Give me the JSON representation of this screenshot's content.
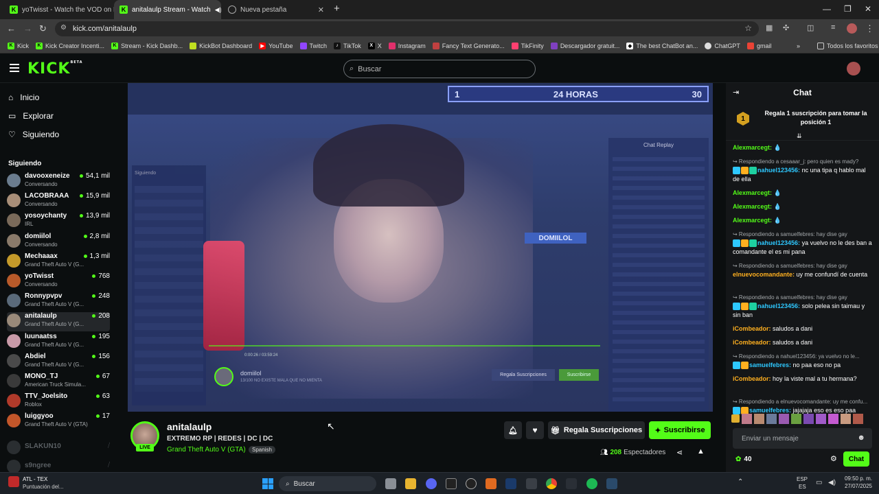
{
  "browser": {
    "tabs": [
      {
        "title": "yoTwisst - Watch the VOD on K"
      },
      {
        "title": "anitalaulp Stream - Watch"
      },
      {
        "title": "Nueva pestaña"
      }
    ],
    "url": "kick.com/anitalaulp",
    "bookmarks": [
      "Kick",
      "Kick Creator Incenti...",
      "Stream - Kick Dashb...",
      "KickBot Dashboard",
      "YouTube",
      "Twitch",
      "TikTok",
      "X",
      "Instagram",
      "Fancy Text Generato...",
      "TikFinity",
      "Descargador gratuit...",
      "The best ChatBot an...",
      "ChatGPT",
      "gmail"
    ],
    "bookmarks_other": "Todos los favoritos"
  },
  "header": {
    "logo": "KICK",
    "beta": "BETA",
    "search_placeholder": "Buscar"
  },
  "sidebar": {
    "nav": [
      {
        "label": "Inicio"
      },
      {
        "label": "Explorar"
      },
      {
        "label": "Siguiendo"
      }
    ],
    "section_title": "Siguiendo",
    "following": [
      {
        "name": "davooxeneize",
        "category": "Conversando",
        "viewers": "54,1 mil",
        "color": "#6b7d8f"
      },
      {
        "name": "LACOBRAAA",
        "category": "Conversando",
        "viewers": "15,9 mil",
        "color": "#a88e78"
      },
      {
        "name": "yosoychanty",
        "category": "IRL",
        "viewers": "13,9 mil",
        "color": "#7a6a5a"
      },
      {
        "name": "domiilol",
        "category": "Conversando",
        "viewers": "2,8 mil",
        "color": "#8a7a6a"
      },
      {
        "name": "Mechaaax",
        "category": "Grand Theft Auto V (G...",
        "viewers": "1,3 mil",
        "color": "#c49a2a"
      },
      {
        "name": "yoTwisst",
        "category": "Conversando",
        "viewers": "768",
        "color": "#b85a2a"
      },
      {
        "name": "Ronnypvpv",
        "category": "Grand Theft Auto V (G...",
        "viewers": "248",
        "color": "#5a6a7a"
      },
      {
        "name": "anitalaulp",
        "category": "Grand Theft Auto V (G...",
        "viewers": "208",
        "color": "#9a8a7a"
      },
      {
        "name": "luunaatss",
        "category": "Grand Theft Auto V (G...",
        "viewers": "195",
        "color": "#c89aa8"
      },
      {
        "name": "Abdiel",
        "category": "Grand Theft Auto V (G...",
        "viewers": "156",
        "color": "#4a4a4a"
      },
      {
        "name": "MONO_TJ",
        "category": "American Truck Simula...",
        "viewers": "67",
        "color": "#3a3a3a"
      },
      {
        "name": "TTV_Joelsito",
        "category": "Roblox",
        "viewers": "63",
        "color": "#b03a2a"
      },
      {
        "name": "luiggyoo",
        "category": "Grand Theft Auto V (GTA)",
        "viewers": "17",
        "color": "#c2562a"
      }
    ],
    "offline": [
      {
        "name": "SLAKUN10"
      },
      {
        "name": "s9ngree"
      }
    ]
  },
  "player": {
    "inner_overlay": {
      "left": "1",
      "center": "24 HORAS",
      "right": "30"
    },
    "nameplate": "DOMIILOL",
    "inner_chat_title": "Chat Replay",
    "inner_sidebar_title": "Siguiendo",
    "inner_bottom_name": "domiilol",
    "inner_bottom_sub": "13/100 NO EXISTE MALA QUE NO MIENTA",
    "inner_gift_btn": "Regala Suscripciones",
    "inner_sub_btn": "Suscribirse",
    "inner_time": "0:00:26 / 03:59:24"
  },
  "channel": {
    "name": "anitalaulp",
    "live_badge": "LIVE",
    "title": "EXTREMO RP | REDES | DC | DC",
    "category": "Grand Theft Auto V (GTA)",
    "language": "Spanish",
    "gift_button": "Regala Suscripciones",
    "subscribe_button": "Suscribirse",
    "viewers_count": "208",
    "viewers_label": "Espectadores"
  },
  "chat": {
    "title": "Chat",
    "pinned_number": "1",
    "pinned_text": "Regala 1 suscripción para tomar la posición 1",
    "messages": [
      {
        "reply": "",
        "user": "Alexmarcegt:",
        "user_color": "#53fc18",
        "text": "💧",
        "badges": 0
      },
      {
        "reply": "↪ Respondiendo a cesaaar_j: pero quien es mady?",
        "user": "nahuel123456:",
        "user_color": "#2ec8ff",
        "text": "nc una tipa q hablo mal de ella",
        "badges": 3
      },
      {
        "reply": "",
        "user": "Alexmarcegt:",
        "user_color": "#53fc18",
        "text": "💧",
        "badges": 0
      },
      {
        "reply": "",
        "user": "Alexmarcegt:",
        "user_color": "#53fc18",
        "text": "💧",
        "badges": 0
      },
      {
        "reply": "",
        "user": "Alexmarcegt:",
        "user_color": "#53fc18",
        "text": "💧",
        "badges": 0
      },
      {
        "reply": "↪ Respondiendo a samuelfebres: hay dise gay",
        "user": "nahuel123456:",
        "user_color": "#2ec8ff",
        "text": "ya vuelvo no le des ban a comandante el es mi pana",
        "badges": 3
      },
      {
        "reply": "↪ Respondiendo a samuelfebres: hay dise gay",
        "user": "elnuevocomandante:",
        "user_color": "#ffb020",
        "text": "uy me confundí de cuenta",
        "badges": 0
      },
      {
        "reply": "↪ Respondiendo a samuelfebres: hay dise gay",
        "user": "nahuel123456:",
        "user_color": "#2ec8ff",
        "text": "solo pelea sin taimau y sin ban",
        "badges": 3
      },
      {
        "reply": "",
        "user": "iCombeador:",
        "user_color": "#ffb020",
        "text": "saludos a dani",
        "badges": 0
      },
      {
        "reply": "",
        "user": "iCombeador:",
        "user_color": "#ffb020",
        "text": "saludos a dani",
        "badges": 0
      },
      {
        "reply": "↪ Respondiendo a nahuel123456: ya vuelvo no le...",
        "user": "samuelfebres:",
        "user_color": "#2ec8ff",
        "text": "no paa eso no pa",
        "badges": 2
      },
      {
        "reply": "",
        "user": "iCombeador:",
        "user_color": "#ffb020",
        "text": "hoy la viste mal a tu hermana?",
        "badges": 0
      },
      {
        "reply": "↪ Respondiendo a elnuevocomandante: uy me confu...",
        "user": "samuelfebres:",
        "user_color": "#2ec8ff",
        "text": "jajajaja eso es eso paa",
        "badges": 2
      }
    ],
    "input_placeholder": "Enviar un mensaje",
    "points": "40",
    "send_button": "Chat"
  },
  "taskbar": {
    "notif_title": "ATL - TEX",
    "notif_sub": "Puntuación del...",
    "search_label": "Buscar",
    "lang": "ESP",
    "lang_sub": "ES",
    "time": "09:50 p. m.",
    "date": "27/07/2025"
  },
  "colors": {
    "accent": "#53fc18",
    "bg": "#0b0e0f",
    "chat_bg": "#141618"
  }
}
